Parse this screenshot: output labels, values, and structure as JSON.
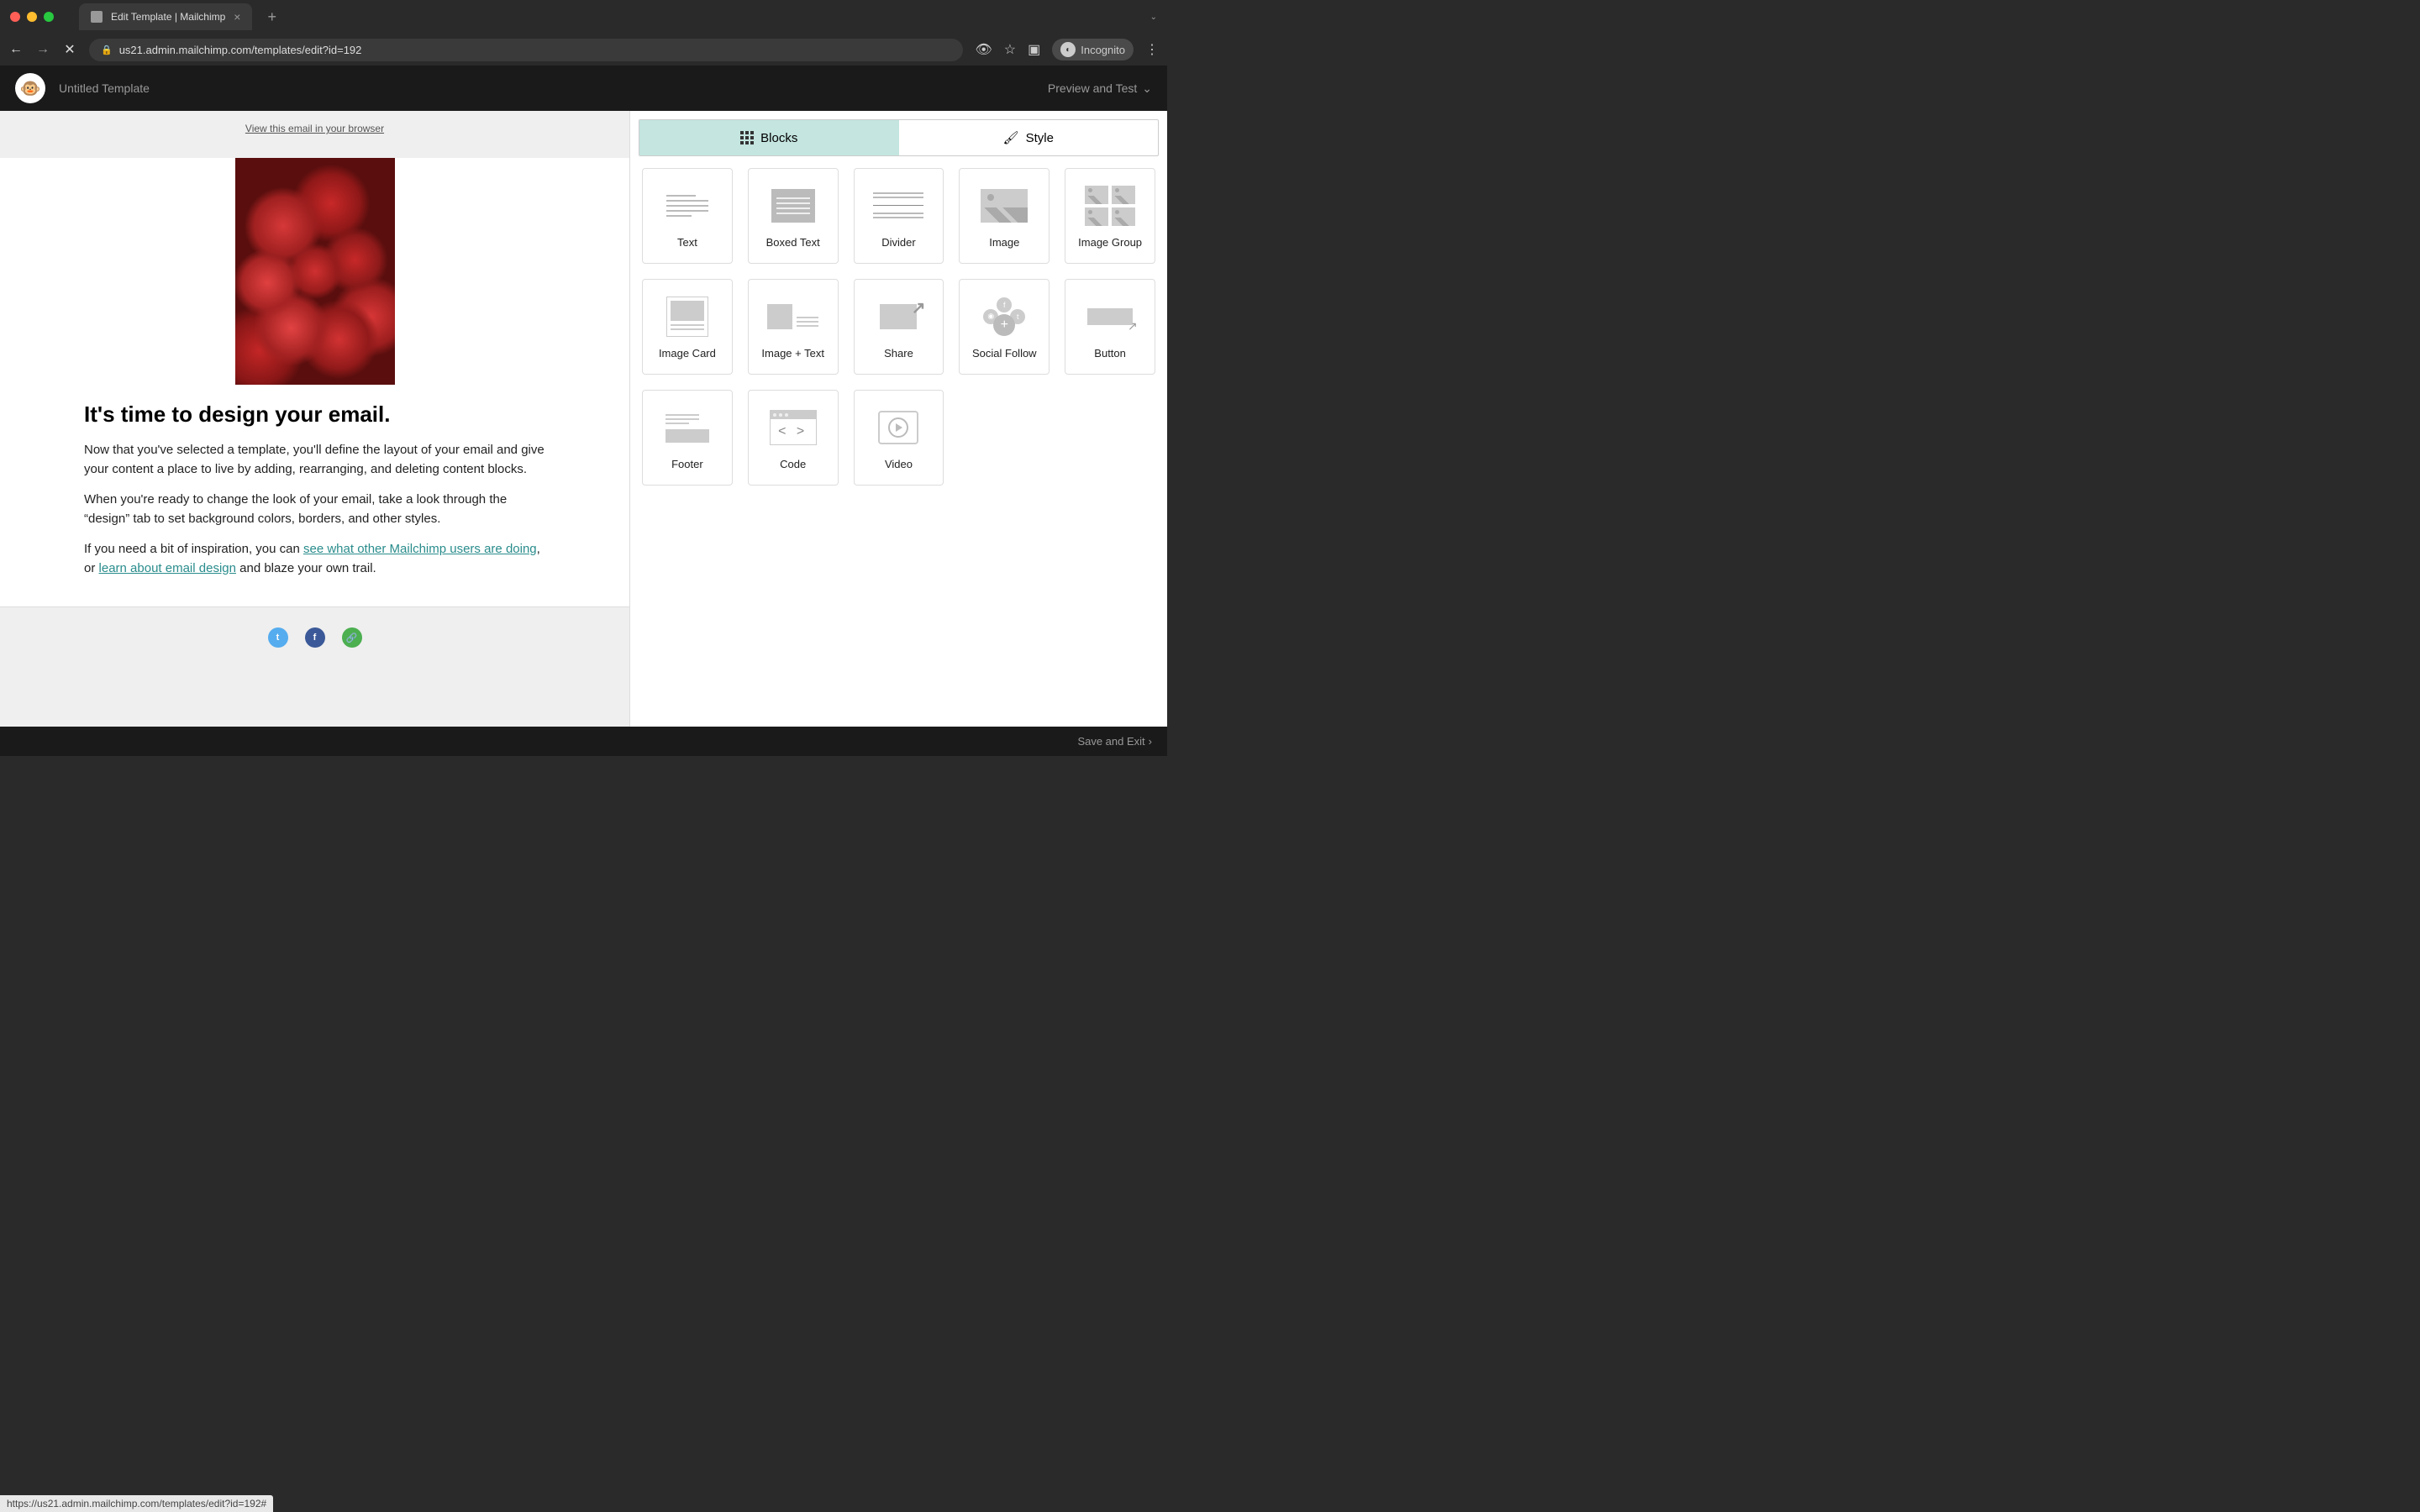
{
  "browser": {
    "tab_title": "Edit Template | Mailchimp",
    "url": "us21.admin.mailchimp.com/templates/edit?id=192",
    "incognito_label": "Incognito",
    "status_url": "https://us21.admin.mailchimp.com/templates/edit?id=192#"
  },
  "header": {
    "template_name": "Untitled Template",
    "preview_label": "Preview and Test"
  },
  "email": {
    "view_in_browser": "View this email in your browser",
    "heading": "It's time to design your email.",
    "p1": "Now that you've selected a template, you'll define the layout of your email and give your content a place to live by adding, rearranging, and deleting content blocks.",
    "p2": "When you're ready to change the look of your email, take a look through the “design” tab to set background colors, borders, and other styles.",
    "p3_before": "If you need a bit of inspiration, you can ",
    "p3_link1": "see what other Mailchimp users are doing",
    "p3_mid": ", or ",
    "p3_link2": "learn about email design",
    "p3_after": " and blaze your own trail."
  },
  "sidebar": {
    "tabs": {
      "blocks": "Blocks",
      "style": "Style"
    },
    "blocks": {
      "text": "Text",
      "boxed_text": "Boxed Text",
      "divider": "Divider",
      "image": "Image",
      "image_group": "Image Group",
      "image_card": "Image Card",
      "image_text": "Image + Text",
      "share": "Share",
      "social_follow": "Social Follow",
      "button": "Button",
      "footer": "Footer",
      "code": "Code",
      "video": "Video"
    }
  },
  "footer": {
    "save_exit": "Save and Exit"
  }
}
